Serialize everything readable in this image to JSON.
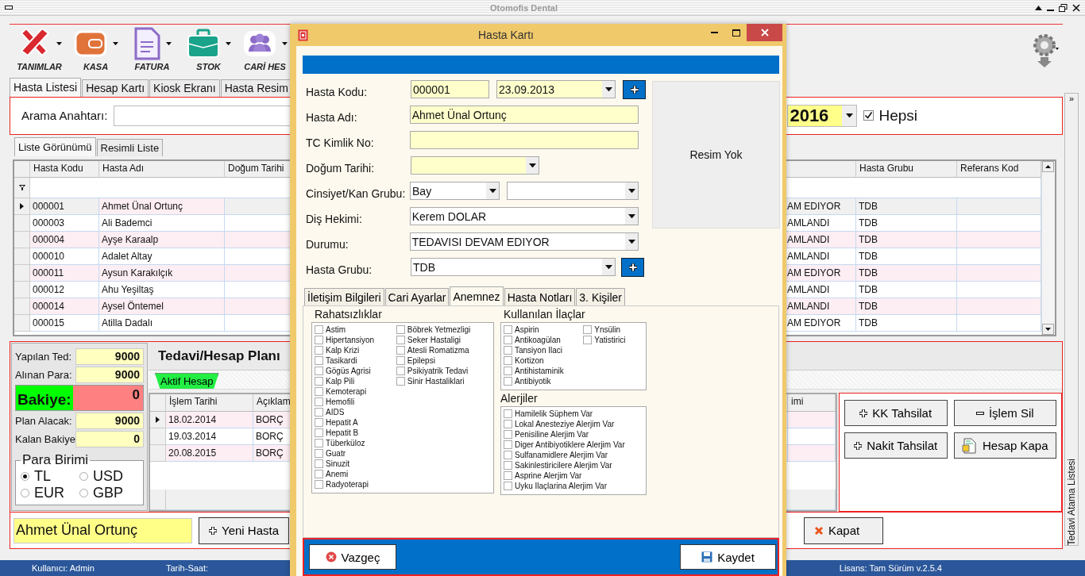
{
  "app": {
    "title": "Otomofis Dental"
  },
  "toolbar": [
    {
      "label": "TANIMLAR",
      "kind": "tools"
    },
    {
      "label": "KASA",
      "kind": "wallet"
    },
    {
      "label": "FATURA",
      "kind": "document"
    },
    {
      "label": "STOK",
      "kind": "briefcase"
    },
    {
      "label": "CARİ HES",
      "kind": "people"
    }
  ],
  "main_tabs": [
    {
      "label": "Hasta Listesi",
      "selected": true
    },
    {
      "label": "Hesap Kartı",
      "selected": false
    },
    {
      "label": "Kiosk Ekranı",
      "selected": false
    },
    {
      "label": "Hasta Resim",
      "selected": false
    }
  ],
  "search": {
    "label": "Arama Anahtarı:",
    "year": "2016",
    "all_label": "Hepsi",
    "all_checked": true
  },
  "view_tabs": [
    {
      "label": "Liste Görünümü",
      "selected": true
    },
    {
      "label": "Resimli Liste",
      "selected": false
    }
  ],
  "patients": {
    "columns": [
      "Hasta Kodu",
      "Hasta Adı",
      "Doğum Tarihi"
    ],
    "right_columns": [
      "Hasta Grubu",
      "Referans Kod"
    ],
    "rows": [
      {
        "code": "000001",
        "name": "Ahmet Ünal Ortunç",
        "status": "AM EDIYOR",
        "group": "TDB",
        "current": true
      },
      {
        "code": "000003",
        "name": "Ali Bademci",
        "status": "AMLANDI",
        "group": "TDB",
        "current": false
      },
      {
        "code": "000004",
        "name": "Ayşe Karaalp",
        "status": "AMLANDI",
        "group": "TDB",
        "current": false
      },
      {
        "code": "000010",
        "name": "Adalet Altay",
        "status": "AMLANDI",
        "group": "TDB",
        "current": false
      },
      {
        "code": "000011",
        "name": "Aysun Karakılçık",
        "status": "AM EDIYOR",
        "group": "TDB",
        "current": false
      },
      {
        "code": "000012",
        "name": "Ahu Yeşiltaş",
        "status": "AMLANDI",
        "group": "TDB",
        "current": false
      },
      {
        "code": "000014",
        "name": "Aysel Öntemel",
        "status": "AMLANDI",
        "group": "TDB",
        "current": false
      },
      {
        "code": "000015",
        "name": "Atilla Dadalı",
        "status": "AM EDIYOR",
        "group": "TDB",
        "current": false
      }
    ]
  },
  "summary": [
    {
      "label": "Yapılan Ted:",
      "value": "9000",
      "kind": "amount"
    },
    {
      "label": "Alınan Para:",
      "value": "9000",
      "kind": "amount"
    },
    {
      "label": "Bakiye:",
      "value": "0",
      "kind": "balance"
    },
    {
      "label": "Plan Alacak:",
      "value": "9000",
      "kind": "amount"
    },
    {
      "label": "Kalan Bakiye",
      "value": "0",
      "kind": "amount"
    }
  ],
  "currency": {
    "title": "Para Birimi",
    "options": [
      {
        "label": "TL",
        "selected": true
      },
      {
        "label": "USD",
        "selected": false
      },
      {
        "label": "EUR",
        "selected": false
      },
      {
        "label": "GBP",
        "selected": false
      }
    ]
  },
  "plan": {
    "title": "Tedavi/Hesap Planı",
    "tab": "Aktif Hesap",
    "columns": [
      "İşlem Tarihi",
      "Açıklam"
    ],
    "last_column": "imi",
    "rows": [
      {
        "date": "18.02.2014",
        "desc": "BORÇ",
        "current": true
      },
      {
        "date": "19.03.2014",
        "desc": "BORÇ",
        "current": false
      },
      {
        "date": "20.08.2015",
        "desc": "BORÇ",
        "current": false
      }
    ]
  },
  "actions": [
    {
      "label": "KK Tahsilat",
      "kind": "plus"
    },
    {
      "label": "İşlem Sil",
      "kind": "minus"
    },
    {
      "label": "Nakit Tahsilat",
      "kind": "plus"
    },
    {
      "label": "Hesap Kapa",
      "kind": "document"
    }
  ],
  "footer": {
    "patient": "Ahmet Ünal Ortunç",
    "new_button": "Yeni Hasta",
    "close_button": "Kapat"
  },
  "side_panel": {
    "toggle": "»",
    "label": "Tedavi Atama Listesi"
  },
  "status_bar": {
    "user": "Kullanıcı:  Admin",
    "datetime": "Tarih-Saat:",
    "license": "Lisans:  Tam Sürüm v.2.5.4"
  },
  "dialog": {
    "title": "Hasta Kartı",
    "fields": [
      {
        "label": "Hasta Kodu:",
        "kind": "code",
        "value": "000001",
        "date": "23.09.2013"
      },
      {
        "label": "Hasta Adı:",
        "kind": "text",
        "value": "Ahmet Ünal Ortunç"
      },
      {
        "label": "TC Kimlik No:",
        "kind": "text"
      },
      {
        "label": "Doğum Tarihi:",
        "kind": "date"
      },
      {
        "label": "Cinsiyet/Kan Grubu:",
        "kind": "pair",
        "value": "Bay"
      },
      {
        "label": "Diş Hekimi:",
        "kind": "select",
        "value": "Kerem DOLAR"
      },
      {
        "label": "Durumu:",
        "kind": "select",
        "value": "TEDAVISI DEVAM EDIYOR"
      },
      {
        "label": "Hasta Grubu:",
        "kind": "select_add",
        "value": "TDB"
      }
    ],
    "photo_label": "Resim Yok",
    "tabs": [
      {
        "label": "İletişim Bilgileri",
        "selected": false
      },
      {
        "label": "Cari Ayarlar",
        "selected": false
      },
      {
        "label": "Anemnez",
        "selected": true
      },
      {
        "label": "Hasta Notları",
        "selected": false
      },
      {
        "label": "3. Kişiler",
        "selected": false
      }
    ],
    "conditions": {
      "title": "Rahatsızlıklar",
      "items": [
        {
          "label": "Astim",
          "checked": false
        },
        {
          "label": "Hipertansiyon",
          "checked": false
        },
        {
          "label": "Kalp Krizi",
          "checked": false
        },
        {
          "label": "Tasikardi",
          "checked": false
        },
        {
          "label": "Gögüs Agrisi",
          "checked": false
        },
        {
          "label": "Kalp Pili",
          "checked": false
        },
        {
          "label": "Kemoterapi",
          "checked": false
        },
        {
          "label": "Hemofili",
          "checked": false
        },
        {
          "label": "AIDS",
          "checked": false
        },
        {
          "label": "Hepatit A",
          "checked": false
        },
        {
          "label": "Hepatit B",
          "checked": false
        },
        {
          "label": "Tüberküloz",
          "checked": false
        },
        {
          "label": "Guatr",
          "checked": false
        },
        {
          "label": "Sinuzit",
          "checked": false
        },
        {
          "label": "Anemi",
          "checked": false
        },
        {
          "label": "Radyoterapi",
          "checked": false
        },
        {
          "label": "Böbrek Yetmezligi",
          "checked": false
        },
        {
          "label": "Seker Hastaligi",
          "checked": false
        },
        {
          "label": "Atesli Romatizma",
          "checked": false
        },
        {
          "label": "Epilepsi",
          "checked": false
        },
        {
          "label": "Psikiyatrik Tedavi",
          "checked": false
        },
        {
          "label": "Sinir Hastaliklari",
          "checked": false
        }
      ]
    },
    "medications": {
      "title": "Kullanılan İlaçlar",
      "items": [
        {
          "label": "Aspirin",
          "checked": false
        },
        {
          "label": "Antikoagülan",
          "checked": false
        },
        {
          "label": "Tansiyon Ilaci",
          "checked": false
        },
        {
          "label": "Kortizon",
          "checked": false
        },
        {
          "label": "Antihistaminik",
          "checked": false
        },
        {
          "label": "Antibiyotik",
          "checked": false
        },
        {
          "label": "Ynsülin",
          "checked": false
        },
        {
          "label": "Yatistirici",
          "checked": false
        }
      ]
    },
    "allergies": {
      "title": "Alerjiler",
      "items": [
        {
          "label": "Hamilelik Süphem Var",
          "checked": false
        },
        {
          "label": "Lokal Anesteziye Alerjim Var",
          "checked": false
        },
        {
          "label": "Penisiline Alerjim Var",
          "checked": false
        },
        {
          "label": "Diger Antibiyotiklere Alerjim Var",
          "checked": false
        },
        {
          "label": "Sulfanamidlere Alerjim Var",
          "checked": false
        },
        {
          "label": "Sakinlestiricilere Alerjim Var",
          "checked": false
        },
        {
          "label": "Asprine Alerjim Var",
          "checked": false
        },
        {
          "label": "Uyku Ilaçlarina Alerjim Var",
          "checked": false
        }
      ]
    },
    "cancel": "Vazgeç",
    "save": "Kaydet"
  }
}
